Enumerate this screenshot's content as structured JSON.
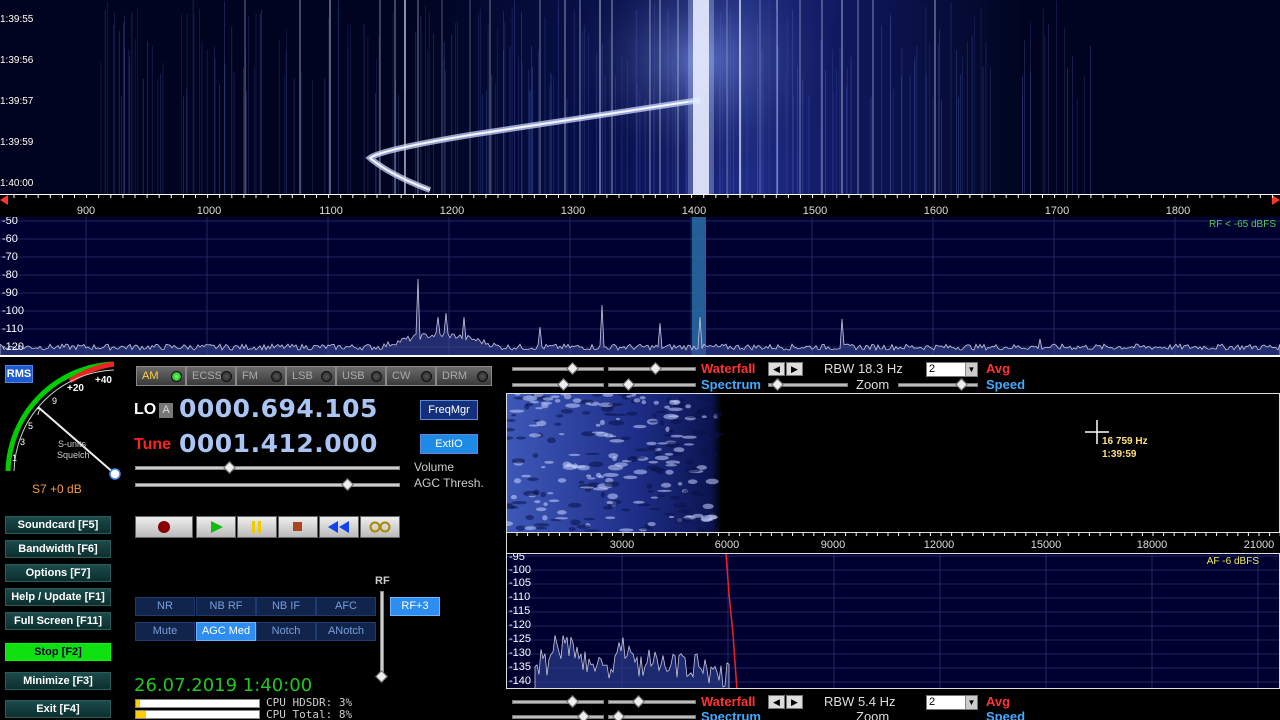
{
  "rf_waterfall": {
    "times": [
      "1:39:55",
      "1:39:56",
      "1:39:57",
      "1:39:59",
      "1:40:00"
    ]
  },
  "rf_axis": {
    "labels": [
      "900",
      "1000",
      "1100",
      "1200",
      "1300",
      "1400",
      "1500",
      "1600",
      "1700",
      "1800"
    ]
  },
  "rf_spectrum": {
    "db_labels": [
      "-50",
      "-60",
      "-70",
      "-80",
      "-90",
      "-100",
      "-110",
      "-120"
    ],
    "level": "RF < -65 dBFS"
  },
  "smeter": {
    "rms_label": "RMS",
    "scale": [
      "+40",
      "+20",
      "9",
      "7",
      "5",
      "3",
      "1"
    ],
    "squelch_label": "S-units\nSquelch",
    "s_units": "S-units",
    "squelch": "Squelch",
    "reading": "S7 +0 dB"
  },
  "modes": [
    {
      "label": "AM",
      "active": true
    },
    {
      "label": "ECSS",
      "active": false
    },
    {
      "label": "FM",
      "active": false
    },
    {
      "label": "LSB",
      "active": false
    },
    {
      "label": "USB",
      "active": false
    },
    {
      "label": "CW",
      "active": false
    },
    {
      "label": "DRM",
      "active": false
    }
  ],
  "lo": {
    "label": "LO",
    "lock": "A",
    "value": "0000.694.105"
  },
  "tune": {
    "label": "Tune",
    "value": "0001.412.000"
  },
  "buttons": {
    "freqmgr": "FreqMgr",
    "extio": "ExtIO"
  },
  "sliders": {
    "volume": "Volume",
    "agc": "AGC Thresh."
  },
  "side_buttons": {
    "soundcard": "Soundcard  [F5]",
    "bandwidth": "Bandwidth  [F6]",
    "options": "Options  [F7]",
    "help": "Help / Update  [F1]",
    "fullscreen": "Full Screen  [F11]",
    "stop": "Stop  [F2]",
    "minimize": "Minimize  [F3]",
    "exit": "Exit  [F4]"
  },
  "dsp": {
    "nr": "NR",
    "nb_rf": "NB RF",
    "nb_if": "NB IF",
    "afc": "AFC",
    "rf_plus": "RF+3",
    "mute": "Mute",
    "agc_med": "AGC Med",
    "notch": "Notch",
    "anotch": "ANotch",
    "rf_label": "RF"
  },
  "status": {
    "datetime": "26.07.2019 1:40:00",
    "cpu_hdsdr": "CPU HDSDR:  3%",
    "cpu_total": "CPU Total:  8%"
  },
  "af_top": {
    "waterfall": "Waterfall",
    "spectrum": "Spectrum",
    "rbw": "RBW 18.3 Hz",
    "avg": "Avg",
    "zoom": "Zoom",
    "speed": "Speed",
    "select": "2"
  },
  "af_cursor": {
    "freq": "16 759 Hz",
    "time": "1:39:59"
  },
  "af_axis": {
    "labels": [
      "3000",
      "6000",
      "9000",
      "12000",
      "15000",
      "18000",
      "21000"
    ]
  },
  "af_spectrum": {
    "db_labels": [
      "-95",
      "-100",
      "-105",
      "-110",
      "-115",
      "-120",
      "-125",
      "-130",
      "-135",
      "-140"
    ],
    "level": "AF  -6 dBFS"
  },
  "af_bottom": {
    "waterfall": "Waterfall",
    "spectrum": "Spectrum",
    "rbw": "RBW  5.4 Hz",
    "avg": "Avg",
    "zoom": "Zoom",
    "speed": "Speed",
    "select": "2"
  }
}
